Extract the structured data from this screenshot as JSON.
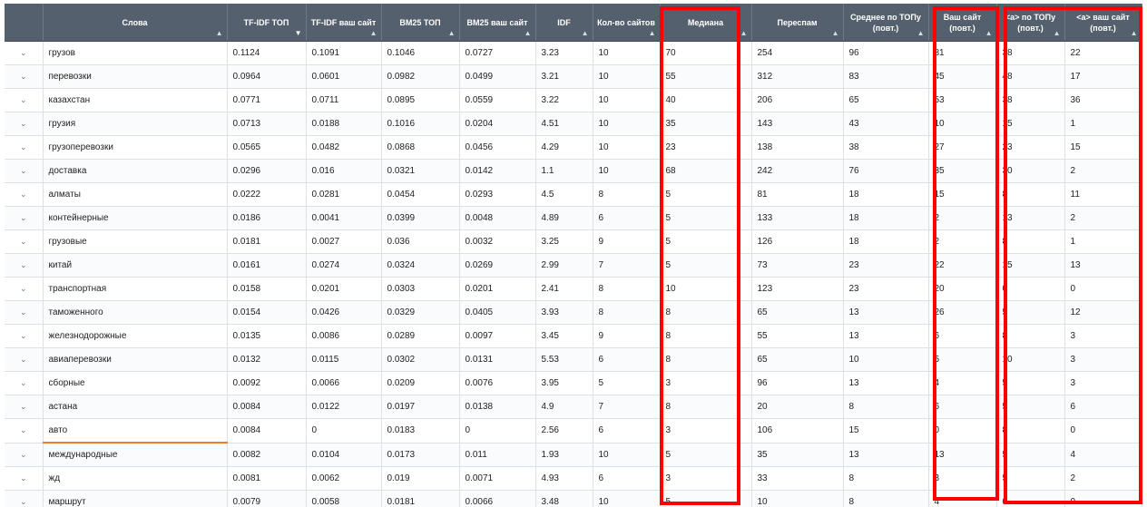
{
  "headers": [
    {
      "label": "",
      "sort": ""
    },
    {
      "label": "Слова",
      "sort": "▲"
    },
    {
      "label": "TF-IDF ТОП",
      "sort": "▼"
    },
    {
      "label": "TF-IDF ваш сайт",
      "sort": "▲"
    },
    {
      "label": "BM25 ТОП",
      "sort": "▲"
    },
    {
      "label": "BM25 ваш сайт",
      "sort": "▲"
    },
    {
      "label": "IDF",
      "sort": "▲"
    },
    {
      "label": "Кол-во сайтов",
      "sort": "▲"
    },
    {
      "label": "Медиана",
      "sort": "▲"
    },
    {
      "label": "Переспам",
      "sort": "▲"
    },
    {
      "label": "Среднее по ТОПу (повт.)",
      "sort": "▲"
    },
    {
      "label": "Ваш сайт (повт.)",
      "sort": "▲"
    },
    {
      "label": "<a> по ТОПу (повт.)",
      "sort": "▲"
    },
    {
      "label": "<a> ваш сайт (повт.)",
      "sort": "▲"
    }
  ],
  "expand_glyph": "⌄",
  "rows": [
    {
      "w": "грузов",
      "c": [
        "0.1124",
        "0.1091",
        "0.1046",
        "0.0727",
        "3.23",
        "10",
        "70",
        "254",
        "96",
        "81",
        "38",
        "22"
      ]
    },
    {
      "w": "перевозки",
      "c": [
        "0.0964",
        "0.0601",
        "0.0982",
        "0.0499",
        "3.21",
        "10",
        "55",
        "312",
        "83",
        "45",
        "48",
        "17"
      ]
    },
    {
      "w": "казахстан",
      "c": [
        "0.0771",
        "0.0711",
        "0.0895",
        "0.0559",
        "3.22",
        "10",
        "40",
        "206",
        "65",
        "53",
        "38",
        "36"
      ]
    },
    {
      "w": "грузия",
      "c": [
        "0.0713",
        "0.0188",
        "0.1016",
        "0.0204",
        "4.51",
        "10",
        "35",
        "143",
        "43",
        "10",
        "15",
        "1"
      ]
    },
    {
      "w": "грузоперевозки",
      "c": [
        "0.0565",
        "0.0482",
        "0.0868",
        "0.0456",
        "4.29",
        "10",
        "23",
        "138",
        "38",
        "27",
        "23",
        "15"
      ]
    },
    {
      "w": "доставка",
      "c": [
        "0.0296",
        "0.016",
        "0.0321",
        "0.0142",
        "1.1",
        "10",
        "68",
        "242",
        "76",
        "35",
        "30",
        "2"
      ]
    },
    {
      "w": "алматы",
      "c": [
        "0.0222",
        "0.0281",
        "0.0454",
        "0.0293",
        "4.5",
        "8",
        "5",
        "81",
        "18",
        "15",
        "8",
        "11"
      ]
    },
    {
      "w": "контейнерные",
      "c": [
        "0.0186",
        "0.0041",
        "0.0399",
        "0.0048",
        "4.89",
        "6",
        "5",
        "133",
        "18",
        "2",
        "13",
        "2"
      ]
    },
    {
      "w": "грузовые",
      "c": [
        "0.0181",
        "0.0027",
        "0.036",
        "0.0032",
        "3.25",
        "9",
        "5",
        "126",
        "18",
        "2",
        "8",
        "1"
      ]
    },
    {
      "w": "китай",
      "c": [
        "0.0161",
        "0.0274",
        "0.0324",
        "0.0269",
        "2.99",
        "7",
        "5",
        "73",
        "23",
        "22",
        "15",
        "13"
      ]
    },
    {
      "w": "транспортная",
      "c": [
        "0.0158",
        "0.0201",
        "0.0303",
        "0.0201",
        "2.41",
        "8",
        "10",
        "123",
        "23",
        "20",
        "0",
        "0"
      ]
    },
    {
      "w": "таможенного",
      "c": [
        "0.0154",
        "0.0426",
        "0.0329",
        "0.0405",
        "3.93",
        "8",
        "8",
        "65",
        "13",
        "26",
        "5",
        "12"
      ]
    },
    {
      "w": "железнодорожные",
      "c": [
        "0.0135",
        "0.0086",
        "0.0289",
        "0.0097",
        "3.45",
        "9",
        "8",
        "55",
        "13",
        "6",
        "8",
        "3"
      ]
    },
    {
      "w": "авиаперевозки",
      "c": [
        "0.0132",
        "0.0115",
        "0.0302",
        "0.0131",
        "5.53",
        "6",
        "8",
        "65",
        "10",
        "5",
        "10",
        "3"
      ]
    },
    {
      "w": "сборные",
      "c": [
        "0.0092",
        "0.0066",
        "0.0209",
        "0.0076",
        "3.95",
        "5",
        "3",
        "96",
        "13",
        "4",
        "5",
        "3"
      ]
    },
    {
      "w": "астана",
      "c": [
        "0.0084",
        "0.0122",
        "0.0197",
        "0.0138",
        "4.9",
        "7",
        "8",
        "20",
        "8",
        "6",
        "5",
        "6"
      ]
    },
    {
      "w": "авто",
      "c": [
        "0.0084",
        "0",
        "0.0183",
        "0",
        "2.56",
        "6",
        "3",
        "106",
        "15",
        "0",
        "8",
        "0"
      ],
      "hl": true
    },
    {
      "w": "международные",
      "c": [
        "0.0082",
        "0.0104",
        "0.0173",
        "0.011",
        "1.93",
        "10",
        "5",
        "35",
        "13",
        "13",
        "5",
        "4"
      ]
    },
    {
      "w": "жд",
      "c": [
        "0.0081",
        "0.0062",
        "0.019",
        "0.0071",
        "4.93",
        "6",
        "3",
        "33",
        "8",
        "3",
        "5",
        "2"
      ]
    },
    {
      "w": "маршрут",
      "c": [
        "0.0079",
        "0.0058",
        "0.0181",
        "0.0066",
        "3.48",
        "10",
        "5",
        "10",
        "8",
        "4",
        "0",
        "0"
      ]
    }
  ],
  "highlight_color": "#ff0000"
}
